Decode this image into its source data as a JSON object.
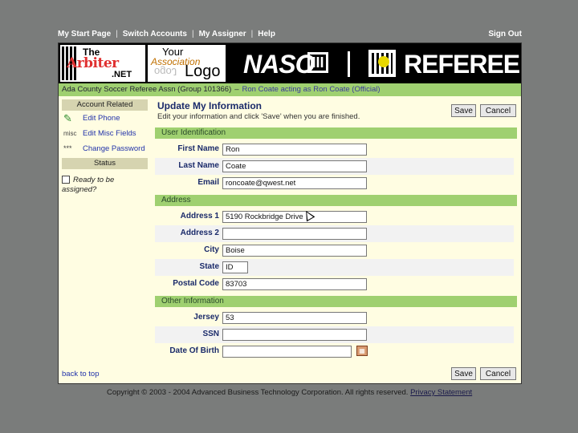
{
  "top_nav": {
    "items": [
      "My Start Page",
      "Switch Accounts",
      "My Assigner",
      "Help"
    ],
    "sign_out": "Sign Out"
  },
  "banner": {
    "arbiter_the": "The",
    "arbiter_name": "Arbiter",
    "arbiter_net": ".NET",
    "assoc_your": "Your",
    "assoc_association": "Association",
    "assoc_logo": "Logo",
    "naso": "NASO",
    "naso_box": "III",
    "referee": "REFEREE"
  },
  "org_bar": {
    "org": "Ada County Soccer Referee Assn (Group 101366)",
    "separator": "–",
    "acting": "Ron Coate acting as Ron Coate (Official)"
  },
  "sidebar": {
    "account_heading": "Account Related",
    "items": [
      {
        "icon": "✎",
        "label": "Edit Phone"
      },
      {
        "icon": "misc",
        "label": "Edit Misc Fields"
      },
      {
        "icon": "***",
        "label": "Change Password"
      }
    ],
    "status_heading": "Status",
    "ready_label": "Ready to be assigned?"
  },
  "page": {
    "title": "Update My Information",
    "subtitle": "Edit your information and click 'Save' when you are finished.",
    "save_label": "Save",
    "cancel_label": "Cancel"
  },
  "sections": {
    "user_identification": "User Identification",
    "address": "Address",
    "other_information": "Other Information"
  },
  "fields": {
    "first_name": {
      "label": "First Name",
      "value": "Ron"
    },
    "last_name": {
      "label": "Last Name",
      "value": "Coate"
    },
    "email": {
      "label": "Email",
      "value": "roncoate@qwest.net"
    },
    "address1": {
      "label": "Address 1",
      "value": "5190 Rockbridge Drive"
    },
    "address2": {
      "label": "Address 2",
      "value": ""
    },
    "city": {
      "label": "City",
      "value": "Boise"
    },
    "state": {
      "label": "State",
      "value": "ID"
    },
    "postal": {
      "label": "Postal Code",
      "value": "83703"
    },
    "jersey": {
      "label": "Jersey",
      "value": "53"
    },
    "ssn": {
      "label": "SSN",
      "value": ""
    },
    "dob": {
      "label": "Date Of Birth",
      "value": ""
    }
  },
  "back_to_top": "back to top",
  "footer": {
    "copyright": "Copyright © 2003 - 2004 Advanced Business Technology Corporation. All rights reserved.",
    "privacy": "Privacy Statement"
  }
}
